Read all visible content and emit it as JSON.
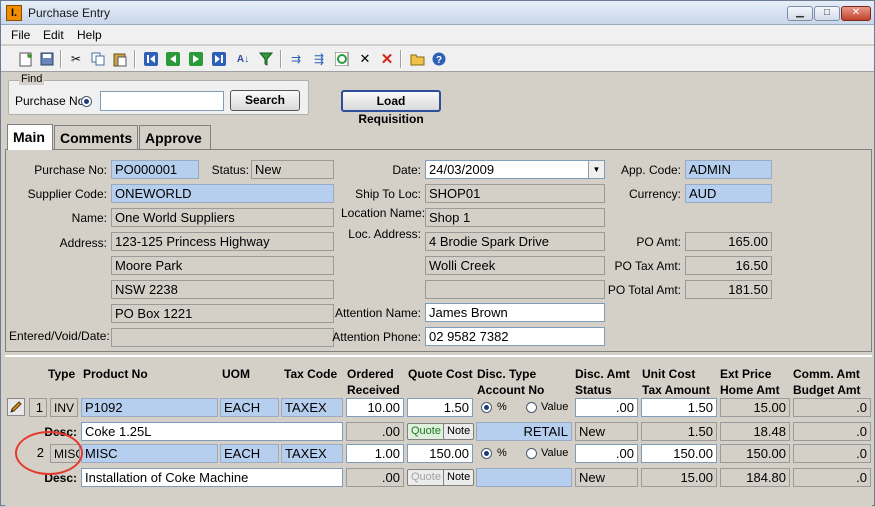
{
  "window": {
    "title": "Purchase Entry",
    "app_icon": "I."
  },
  "menu": [
    "File",
    "Edit",
    "Help"
  ],
  "toolbar_icons": [
    "new-icon",
    "save-icon",
    "cut-icon",
    "copy-icon",
    "paste-icon",
    "first-icon",
    "prev-icon",
    "next-icon",
    "last-icon",
    "sort-icon",
    "filter-icon",
    "indent-icon",
    "outdent-icon",
    "refresh-icon",
    "clear-icon",
    "delete-icon",
    "open-folder-icon",
    "help-icon"
  ],
  "find": {
    "legend": "Find",
    "radio_label": "Purchase No",
    "value": "",
    "search_label": "Search"
  },
  "load_requisition_label": "Load Requisition",
  "tabs": [
    "Main",
    "Comments",
    "Approve"
  ],
  "form": {
    "purchase_no_label": "Purchase No:",
    "purchase_no": "PO000001",
    "status_label": "Status:",
    "status": "New",
    "supplier_code_label": "Supplier Code:",
    "supplier_code": "ONEWORLD",
    "name_label": "Name:",
    "name": "One World Suppliers",
    "address_label": "Address:",
    "address": [
      "123-125 Princess Highway",
      "Moore Park",
      "NSW 2238",
      "PO Box 1221"
    ],
    "entered_label": "Entered/Void/Date:",
    "entered": "",
    "date_label": "Date:",
    "date": "24/03/2009",
    "ship_to_label": "Ship To Loc:",
    "ship_to": "SHOP01",
    "location_name_label": "Location Name:",
    "location_name": "Shop 1",
    "loc_address_label": "Loc. Address:",
    "loc_address": [
      "4 Brodie Spark Drive",
      "Wolli Creek",
      ""
    ],
    "attention_name_label": "Attention Name:",
    "attention_name": "James Brown",
    "attention_phone_label": "Attention Phone:",
    "attention_phone": "02 9582 7382",
    "app_code_label": "App. Code:",
    "app_code": "ADMIN",
    "currency_label": "Currency:",
    "currency": "AUD",
    "po_amt_label": "PO Amt:",
    "po_amt": "165.00",
    "po_tax_label": "PO Tax Amt:",
    "po_tax": "16.50",
    "po_total_label": "PO Total Amt:",
    "po_total": "181.50"
  },
  "grid": {
    "headers": {
      "type": "Type",
      "product": "Product No",
      "uom": "UOM",
      "tax": "Tax Code",
      "ordered": "Ordered",
      "received": "Received",
      "quote": "Quote Cost",
      "disc_type": "Disc. Type",
      "account": "Account No",
      "disc_amt": "Disc. Amt",
      "status": "Status",
      "unit_cost": "Unit Cost",
      "tax_amount": "Tax Amount",
      "ext_price": "Ext Price",
      "home_amt": "Home Amt",
      "comm_amt": "Comm. Amt",
      "budget_amt": "Budget Amt"
    },
    "desc_label": "Desc:",
    "quote_btn": "Quote",
    "note_btn": "Note",
    "pct_label": "%",
    "value_label": "Value",
    "rows": [
      {
        "no": "1",
        "type": "INV",
        "product": "P1092",
        "uom": "EACH",
        "tax": "TAXEX",
        "ordered": "10.00",
        "quote": "1.50",
        "disc_amt": ".00",
        "unit_cost": "1.50",
        "ext_price": "15.00",
        "comm": ".0",
        "desc": "Coke 1.25L",
        "received": ".00",
        "account": "RETAIL",
        "status": "New",
        "tax_amount": "1.50",
        "home_amt": "18.48",
        "budget": ".0"
      },
      {
        "no": "2",
        "type": "MISC",
        "product": "MISC",
        "uom": "EACH",
        "tax": "TAXEX",
        "ordered": "1.00",
        "quote": "150.00",
        "disc_amt": ".00",
        "unit_cost": "150.00",
        "ext_price": "150.00",
        "comm": ".0",
        "desc": "Installation of Coke Machine",
        "received": ".00",
        "account": "",
        "status": "New",
        "tax_amount": "15.00",
        "home_amt": "184.80",
        "budget": ".0"
      }
    ]
  }
}
